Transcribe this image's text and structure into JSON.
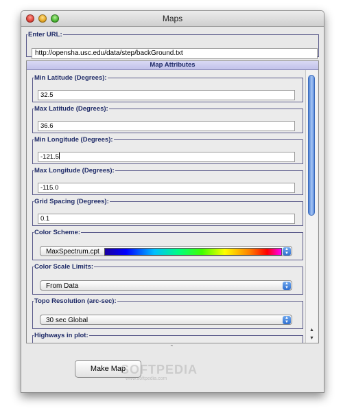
{
  "window": {
    "title": "Maps"
  },
  "url_section": {
    "label": "Enter URL:",
    "value": "http://opensha.usc.edu/data/step/backGround.txt"
  },
  "map_attributes": {
    "header": "Map Attributes",
    "min_latitude": {
      "label": "Min Latitude (Degrees):",
      "value": "32.5"
    },
    "max_latitude": {
      "label": "Max Latitude (Degrees):",
      "value": "36.6"
    },
    "min_longitude": {
      "label": "Min Longitude (Degrees):",
      "value": "-121.5"
    },
    "max_longitude": {
      "label": "Max Longitude (Degrees):",
      "value": "-115.0"
    },
    "grid_spacing": {
      "label": "Grid Spacing (Degrees):",
      "value": "0.1"
    },
    "color_scheme": {
      "label": "Color Scheme:",
      "value": "MaxSpectrum.cpt"
    },
    "color_scale_limits": {
      "label": "Color Scale Limits:",
      "value": "From Data"
    },
    "topo_resolution": {
      "label": "Topo Resolution (arc-sec):",
      "value": "30 sec Global"
    },
    "highways": {
      "label": "Highways in plot:"
    }
  },
  "actions": {
    "make_map": "Make Map"
  },
  "watermark": {
    "text": "SOFTPEDIA",
    "sub": "www.softpedia.com"
  },
  "colors": {
    "legend_text": "#1f2b68",
    "header_bg": "#c8c8ee",
    "scroll_thumb": "#6f9be4"
  }
}
